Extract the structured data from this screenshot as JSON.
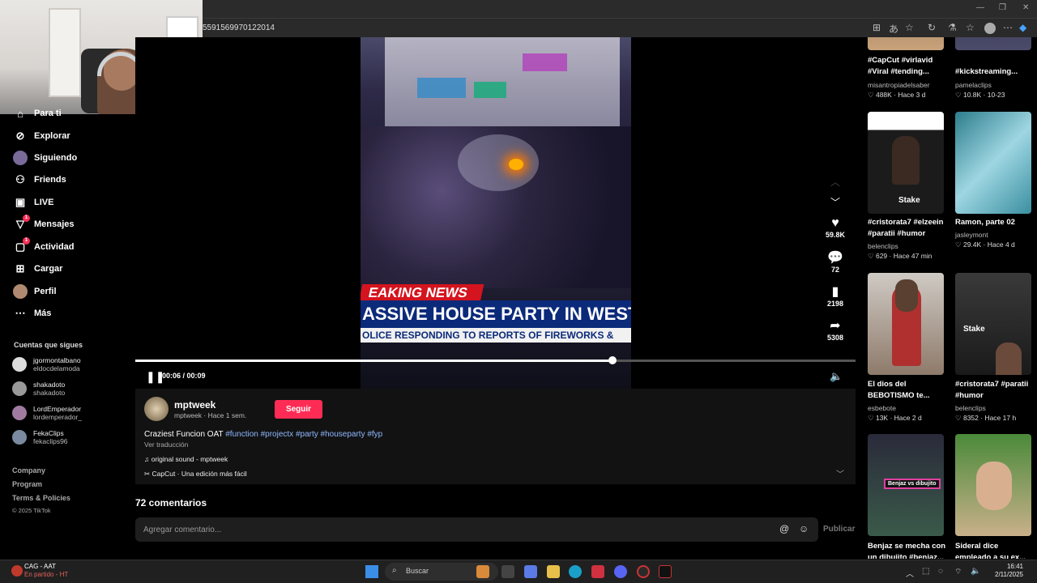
{
  "browser": {
    "url": "5591569970122014",
    "tb_icons": [
      "⊞",
      "あ",
      "☆",
      "↻",
      "⚗",
      "☆",
      "⧉",
      "●",
      "⋯",
      "◆"
    ]
  },
  "sidebar": {
    "partial_top": "Para ti",
    "items": [
      {
        "label": "Explorar",
        "icon": "compass-icon",
        "glyph": "⊘",
        "badge": ""
      },
      {
        "label": "Siguiendo",
        "icon": "following-icon",
        "glyph": "●",
        "badge": ""
      },
      {
        "label": "Friends",
        "icon": "friends-icon",
        "glyph": "👥",
        "badge": ""
      },
      {
        "label": "LIVE",
        "icon": "live-icon",
        "glyph": "▣",
        "badge": ""
      },
      {
        "label": "Mensajes",
        "icon": "messages-icon",
        "glyph": "▽",
        "badge": "1"
      },
      {
        "label": "Actividad",
        "icon": "activity-icon",
        "glyph": "▢",
        "badge": "1"
      },
      {
        "label": "Cargar",
        "icon": "upload-icon",
        "glyph": "⊞",
        "badge": ""
      },
      {
        "label": "Perfil",
        "icon": "profile-icon",
        "glyph": "●",
        "badge": ""
      },
      {
        "label": "Más",
        "icon": "more-icon",
        "glyph": "⋯",
        "badge": ""
      }
    ],
    "following_title": "Cuentas que sigues",
    "following": [
      {
        "name": "jgormontalbano",
        "handle": "eldocdelamoda"
      },
      {
        "name": "shakadoto",
        "handle": "shakadoto"
      },
      {
        "name": "LordEmperador",
        "handle": "lordemperador_"
      },
      {
        "name": "FekaClips",
        "handle": "fekaclips96"
      }
    ],
    "footer": [
      "Company",
      "Program",
      "Terms & Policies",
      "© 2025 TikTok"
    ]
  },
  "video": {
    "news_red": "EAKING NEWS",
    "news_blue": "ASSIVE HOUSE PARTY IN WEST",
    "news_white": "OLICE RESPONDING TO REPORTS OF FIREWORKS &",
    "time": "00:06 / 00:09",
    "progress": 0.662
  },
  "rail": {
    "likes": "59.8K",
    "comments": "72",
    "saves": "2198",
    "shares": "5308"
  },
  "post": {
    "author": "mptweek",
    "author_sub": "mptweek · Hace 1 sem.",
    "follow_label": "Seguir",
    "desc_text": "Craziest Funcion OAT ",
    "tags": "#function #projectx #party #houseparty #fyp",
    "translate": "Ver traducción",
    "sound": "♫ original sound - mptweek",
    "capcut": "✂ CapCut · Una edición más fácil"
  },
  "comments": {
    "title": "72 comentarios",
    "placeholder": "Agregar comentario...",
    "publish": "Publicar"
  },
  "recommended": [
    {
      "title": "#CapCut #virlavid #Viral #tending...",
      "author": "misantropiadelsaber",
      "meta": "♡ 488K · Hace 3 d"
    },
    {
      "title": "#kickstreaming...",
      "author": "pamelaclips",
      "meta": "♡ 10.8K · 10-23"
    },
    {
      "title": "#cristorata7 #elzeein #paratii #humor",
      "author": "belenclips",
      "meta": "♡ 629 · Hace 47 min"
    },
    {
      "title": "Ramon, parte 02",
      "author": "jasleymont",
      "meta": "♡ 29.4K · Hace 4 d"
    },
    {
      "title": "El dios del BEBOTISMO te...",
      "author": "esbebote",
      "meta": "♡ 13K · Hace 2 d"
    },
    {
      "title": "#cristorata7 #paratii #humor",
      "author": "belenclips",
      "meta": "♡ 8352 · Hace 17 h"
    },
    {
      "title": "Benjaz se mecha con un dibujito #benjaz...",
      "author": "",
      "meta": ""
    },
    {
      "title": "Sideral dice empleado a su ex...",
      "author": "",
      "meta": ""
    }
  ],
  "thumb_labels": {
    "stake": "Stake",
    "benjaz": "Benjaz vs dibujito"
  },
  "taskbar": {
    "weather_title": "CAG - AAT",
    "weather_sub": "En partido - HT",
    "search": "Buscar",
    "time": "16:41",
    "date": "2/11/2025"
  }
}
